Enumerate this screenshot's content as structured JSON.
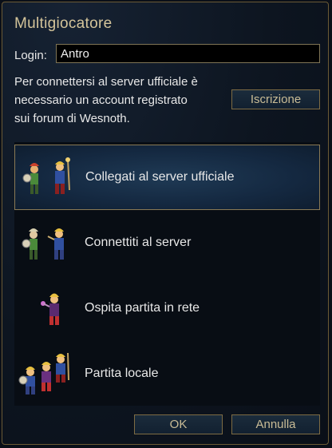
{
  "dialog": {
    "title": "Multigiocatore",
    "login_label": "Login:",
    "login_value": "Antro",
    "info_lines": [
      "Per connettersi al server ufficiale è",
      "necessario un account registrato",
      "sui forum di Wesnoth."
    ],
    "register_label": "Iscrizione",
    "ok_label": "OK",
    "cancel_label": "Annulla"
  },
  "options": [
    {
      "label": "Collegati al server ufficiale",
      "icon": "two-units-icon",
      "selected": true
    },
    {
      "label": "Connettiti al server",
      "icon": "two-units-icon",
      "selected": false
    },
    {
      "label": "Ospita partita in rete",
      "icon": "single-unit-icon",
      "selected": false
    },
    {
      "label": "Partita locale",
      "icon": "three-units-icon",
      "selected": false
    }
  ],
  "colors": {
    "accent_gold": "#c9bc96",
    "border_gold": "#7e6c44",
    "background": "#0a0f18",
    "selected_bg": "#1f3a55"
  }
}
